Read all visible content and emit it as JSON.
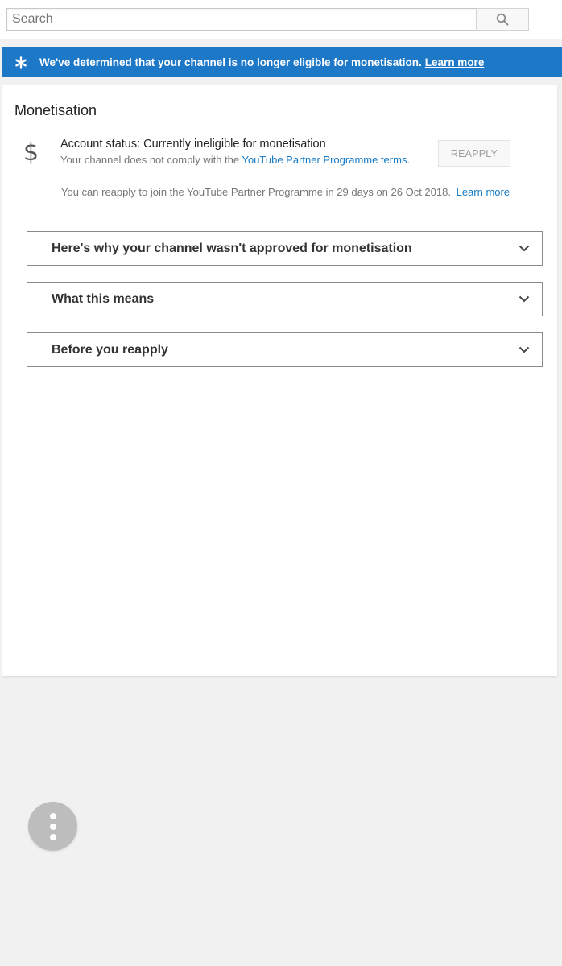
{
  "search": {
    "placeholder": "Search",
    "button_icon": "search-icon"
  },
  "banner": {
    "icon": "asterisk-icon",
    "message": "We've determined that your channel is no longer eligible for monetisation.",
    "link_label": "Learn more",
    "background_color": "#1e78c8"
  },
  "monetisation": {
    "title": "Monetisation",
    "status_icon": "dollar-icon",
    "status_title": "Account status: Currently ineligible for monetisation",
    "status_desc_prefix": "Your channel does not comply with the ",
    "terms_link": "YouTube Partner Programme terms.",
    "reapply_button": "REAPPLY",
    "reapply_info": "You can reapply to join the YouTube Partner Programme in 29 days on 26 Oct 2018.",
    "reapply_info_link": "Learn more",
    "link_color": "#167ac6"
  },
  "accordions": [
    {
      "label": "Here's why your channel wasn't approved for monetisation",
      "icon": "chevron-down-icon"
    },
    {
      "label": "What this means",
      "icon": "chevron-down-icon"
    },
    {
      "label": "Before you reapply",
      "icon": "chevron-down-icon"
    }
  ],
  "fab": {
    "icon": "more-vertical-icon"
  }
}
